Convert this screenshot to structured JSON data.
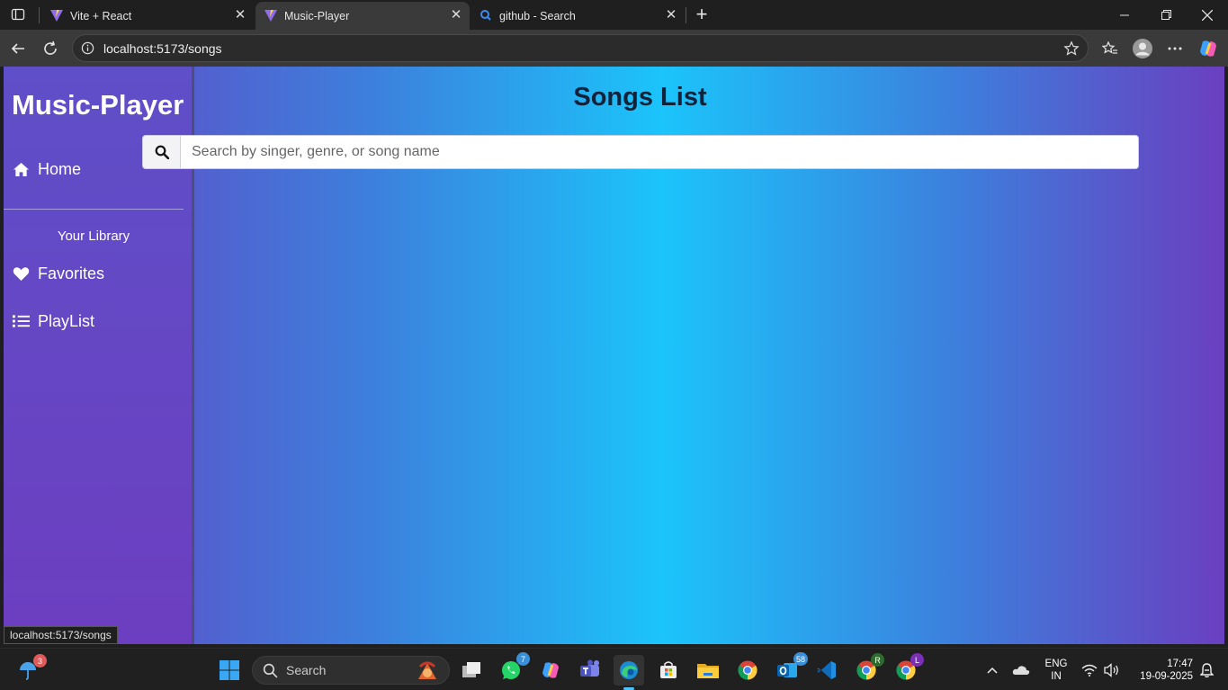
{
  "browser": {
    "tabs": [
      {
        "title": "Vite + React",
        "active": false
      },
      {
        "title": "Music-Player",
        "active": true
      },
      {
        "title": "github - Search",
        "active": false
      }
    ],
    "new_tab_label": "+",
    "url": "localhost:5173/songs",
    "status_url": "localhost:5173/songs"
  },
  "app": {
    "brand": "Music-Player",
    "sidebar": {
      "home": "Home",
      "library_title": "Your Library",
      "favorites": "Favorites",
      "playlist": "PlayList"
    },
    "main": {
      "title": "Songs List",
      "search_placeholder": "Search by singer, genre, or song name"
    }
  },
  "taskbar": {
    "search_label": "Search",
    "weather_badge": "3",
    "whatsapp_badge": "7",
    "outlook_badge": "58",
    "chrome_profile_r": "R",
    "chrome_profile_l": "L",
    "lang_line1": "ENG",
    "lang_line2": "IN",
    "time": "17:47",
    "date": "19-09-2025"
  },
  "colors": {
    "gradient_edge": "#6a3fc0",
    "gradient_center": "#1bc4fb",
    "title_text": "#10233a"
  }
}
